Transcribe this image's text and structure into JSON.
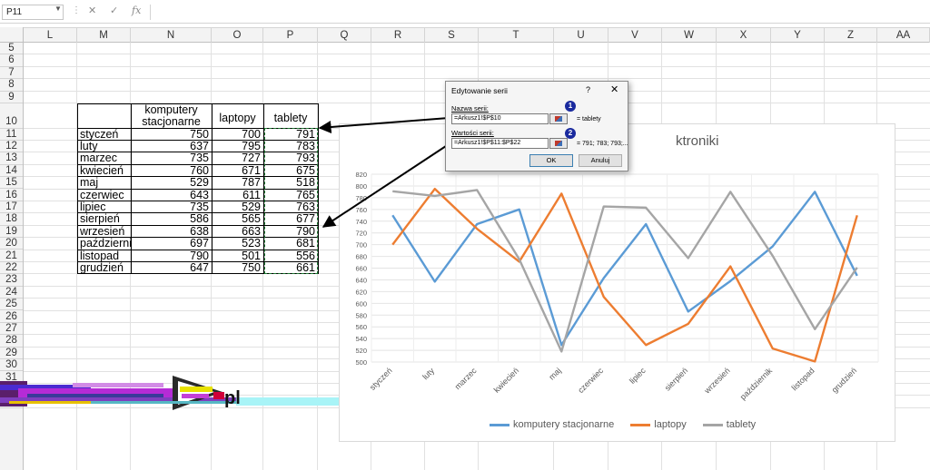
{
  "formula_bar": {
    "name_box": "P11",
    "formula": ""
  },
  "columns": [
    "L",
    "M",
    "N",
    "O",
    "P",
    "Q",
    "R",
    "S",
    "T",
    "U",
    "V",
    "W",
    "X",
    "Y",
    "Z",
    "AA"
  ],
  "rows": [
    "5",
    "6",
    "7",
    "8",
    "9",
    "10",
    "11",
    "12",
    "13",
    "14",
    "15",
    "16",
    "17",
    "18",
    "19",
    "20",
    "21",
    "22",
    "23",
    "24",
    "25",
    "26",
    "27",
    "28",
    "29",
    "30",
    "31",
    "32",
    "33"
  ],
  "table": {
    "headers": [
      "komputery stacjonarne",
      "laptopy",
      "tablety"
    ],
    "months": [
      "styczeń",
      "luty",
      "marzec",
      "kwiecień",
      "maj",
      "czerwiec",
      "lipiec",
      "sierpień",
      "wrzesień",
      "październi",
      "listopad",
      "grudzień"
    ],
    "komputery": [
      "750",
      "637",
      "735",
      "760",
      "529",
      "643",
      "735",
      "586",
      "638",
      "697",
      "790",
      "647"
    ],
    "laptopy": [
      "700",
      "795",
      "727",
      "671",
      "787",
      "611",
      "529",
      "565",
      "663",
      "523",
      "501",
      "750"
    ],
    "tablety": [
      "791",
      "783",
      "793",
      "675",
      "518",
      "765",
      "763",
      "677",
      "790",
      "681",
      "556",
      "661"
    ]
  },
  "dialog": {
    "title": "Edytowanie serii",
    "help": "?",
    "close": "✕",
    "name_label": "Nazwa serii:",
    "name_value": "=Arkusz1!$P$10",
    "name_result": "= tablety",
    "values_label": "Wartości serii:",
    "values_value": "=Arkusz1!$P$11:$P$22",
    "values_result": "= 791; 783; 793;...",
    "ok": "OK",
    "cancel": "Anuluj",
    "badge1": "1",
    "badge2": "2"
  },
  "watermark_text": "pl",
  "chart_data": {
    "type": "line",
    "title": "ktroniki",
    "categories": [
      "styczeń",
      "luty",
      "marzec",
      "kwiecień",
      "maj",
      "czerwiec",
      "lipiec",
      "sierpień",
      "wrzesień",
      "październik",
      "listopad",
      "grudzień"
    ],
    "ylim": [
      500,
      820
    ],
    "yticks": [
      "500",
      "520",
      "540",
      "560",
      "580",
      "600",
      "620",
      "640",
      "660",
      "680",
      "700",
      "720",
      "740",
      "760",
      "780",
      "800",
      "820"
    ],
    "series": [
      {
        "name": "komputery stacjonarne",
        "color": "#5b9bd5",
        "values": [
          750,
          637,
          735,
          760,
          529,
          643,
          735,
          586,
          638,
          697,
          790,
          647
        ]
      },
      {
        "name": "laptopy",
        "color": "#ed7d31",
        "values": [
          700,
          795,
          727,
          671,
          787,
          611,
          529,
          565,
          663,
          523,
          501,
          750
        ]
      },
      {
        "name": "tablety",
        "color": "#a5a5a5",
        "values": [
          791,
          783,
          793,
          675,
          518,
          765,
          763,
          677,
          790,
          681,
          556,
          661
        ]
      }
    ],
    "grid": true,
    "legend": "bottom"
  }
}
